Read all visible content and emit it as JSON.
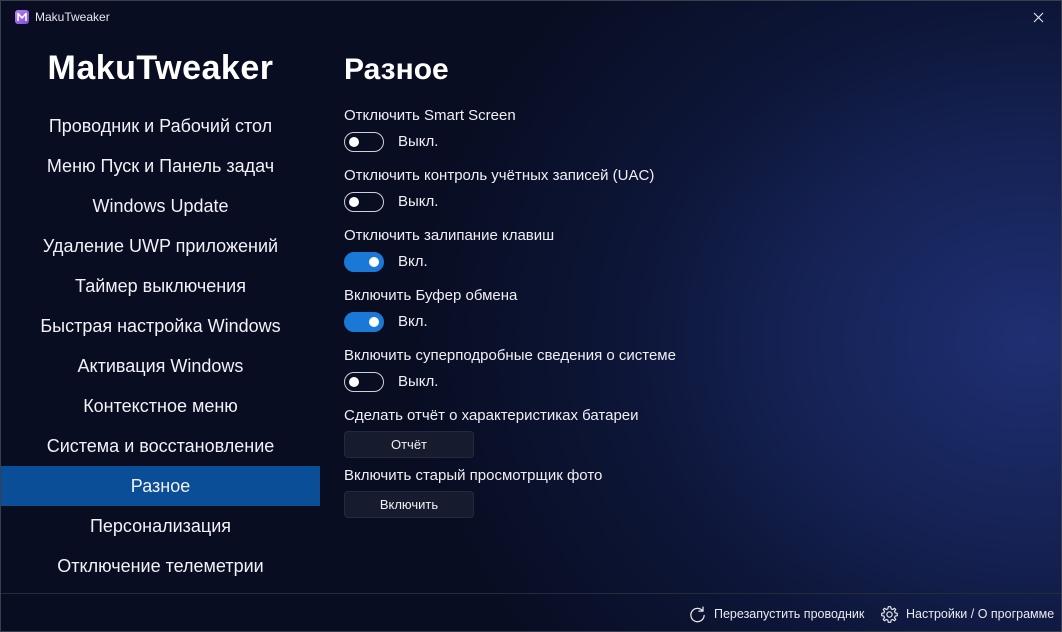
{
  "window": {
    "title": "MakuTweaker",
    "close_glyph": "✕"
  },
  "sidebar": {
    "title": "MakuTweaker",
    "items": [
      {
        "label": "Проводник и Рабочий стол"
      },
      {
        "label": "Меню Пуск и Панель задач"
      },
      {
        "label": "Windows Update"
      },
      {
        "label": "Удаление UWP приложений"
      },
      {
        "label": "Таймер выключения"
      },
      {
        "label": "Быстрая настройка Windows"
      },
      {
        "label": "Активация Windows"
      },
      {
        "label": "Контекстное меню"
      },
      {
        "label": "Система и восстановление"
      },
      {
        "label": "Разное",
        "active": true
      },
      {
        "label": "Персонализация"
      },
      {
        "label": "Отключение телеметрии"
      }
    ]
  },
  "main": {
    "title": "Разное",
    "toggles": [
      {
        "label": "Отключить Smart Screen",
        "state_text": "Выкл.",
        "on": false
      },
      {
        "label": "Отключить контроль учётных записей (UAC)",
        "state_text": "Выкл.",
        "on": false
      },
      {
        "label": "Отключить залипание клавиш",
        "state_text": "Вкл.",
        "on": true
      },
      {
        "label": "Включить Буфер обмена",
        "state_text": "Вкл.",
        "on": true
      },
      {
        "label": "Включить суперподробные сведения о системе",
        "state_text": "Выкл.",
        "on": false
      }
    ],
    "actions": [
      {
        "label": "Сделать отчёт о характеристиках батареи",
        "button": "Отчёт"
      },
      {
        "label": "Включить старый просмотрщик фото",
        "button": "Включить"
      }
    ]
  },
  "footer": {
    "restart_explorer": "Перезапустить проводник",
    "settings_about": "Настройки / О программе"
  },
  "colors": {
    "accent": "#1a78d6",
    "active_nav": "#0a4e98",
    "background_dark": "#080d22",
    "background_glow": "#1f2f72"
  },
  "icons": {
    "app": "maku-app-icon",
    "close": "close-icon",
    "restart": "refresh-icon",
    "settings": "gear-icon"
  }
}
